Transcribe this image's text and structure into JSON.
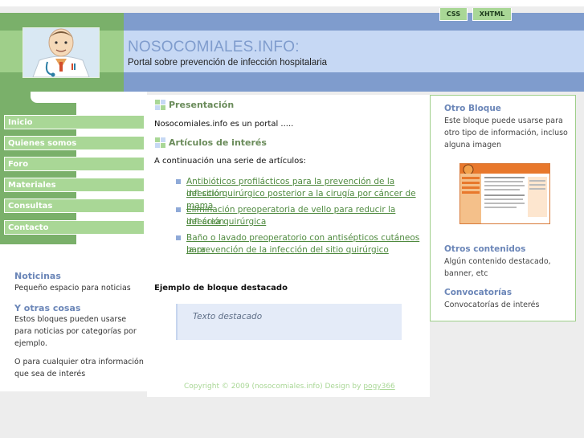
{
  "header": {
    "site_title": "NOSOCOMIALES.INFO:",
    "site_subtitle": "Portal sobre prevención de infección hospitalaria",
    "badge_css": "CSS",
    "badge_xhtml": "XHTML"
  },
  "nav": {
    "items": [
      {
        "label": "Inicio"
      },
      {
        "label": "Quienes somos"
      },
      {
        "label": "Foro"
      },
      {
        "label": "Materiales"
      },
      {
        "label": "Consultas"
      },
      {
        "label": "Contacto"
      }
    ]
  },
  "left_blocks": {
    "noticias_title": "Noticinas",
    "noticias_text": "Pequeño espacio para noticias",
    "otras_title": "Y otras cosas",
    "otras_text_1": "Estos bloques pueden usarse",
    "otras_text_2": "para noticias por categorías por",
    "otras_text_3": "ejemplo.",
    "extra_text_1": "O para cualquier otra información",
    "extra_text_2": "que sea de interés"
  },
  "main": {
    "presentacion_title": "Presentación",
    "presentacion_text": "Nosocomiales.info es un portal .....",
    "articulos_title": "Artículos de interés",
    "articulos_intro": "A continuación una serie de artículos:",
    "articles": [
      {
        "line1": "Antibióticos profilácticos para la prevención de la infección",
        "line2": "del sitio quirúrgico posterior a la cirugía por cáncer de mama"
      },
      {
        "line1": "Eliminación preoperatoria de vello para reducir la infección",
        "line2": "del área quirúrgica"
      },
      {
        "line1": "Baño o lavado preoperatorio con antisépticos cutáneos para",
        "line2": "la prevención de la infección del sitio quirúrgico"
      }
    ],
    "featured_title": "Ejemplo de bloque destacado",
    "featured_text": "Texto destacado",
    "copyright": "Copyright © 2009 (nosocomiales.info)",
    "design_by": "Design by",
    "designer": "pogy366"
  },
  "right": {
    "otro_title": "Otro Bloque",
    "otro_text_1": "Este bloque puede usarse para",
    "otro_text_2": "otro tipo de información, incluso",
    "otro_text_3": "alguna imagen",
    "otros_title": "Otros contenidos",
    "otros_text_1": "Algún contenido destacado,",
    "otros_text_2": "banner, etc",
    "conv_title": "Convocatorías",
    "conv_text": "Convocatorías de interés"
  },
  "colors": {
    "green_dark": "#7ab06a",
    "green_light": "#a9d796",
    "blue_dark": "#7f9ccd",
    "blue_light": "#c6d8f4",
    "link_green": "#4f8a3f"
  }
}
